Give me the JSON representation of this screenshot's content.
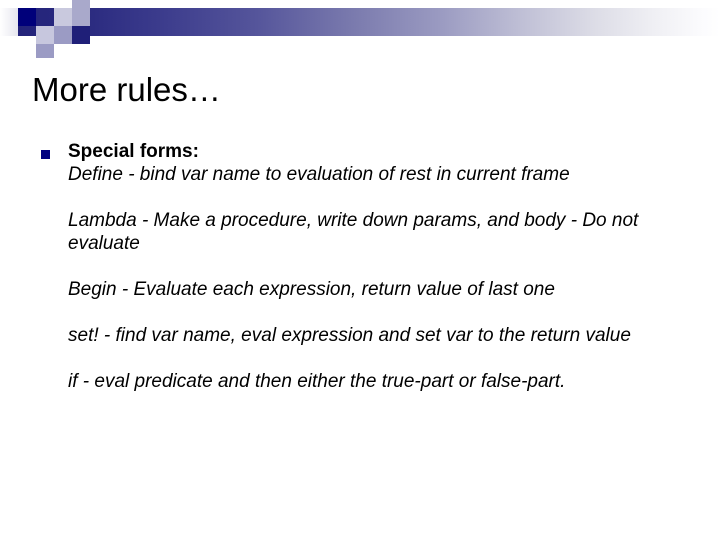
{
  "slide": {
    "title": "More rules…",
    "header_decoration": {
      "name": "gradient-banner",
      "gradient_start_color": "#23237a",
      "gradient_end_color": "#ffffff",
      "accent_square_color": "#00007a"
    },
    "bullet": {
      "marker_color": "#000080",
      "lead_label": "Special forms:"
    },
    "paragraphs": [
      "Define - bind var name to evaluation of rest in current frame",
      "Lambda - Make a procedure, write down params, and body - Do not evaluate",
      "Begin - Evaluate each expression, return value of last one",
      "set! - find var name, eval expression and set var to the return value",
      "if - eval predicate and then either the true-part or false-part."
    ]
  }
}
